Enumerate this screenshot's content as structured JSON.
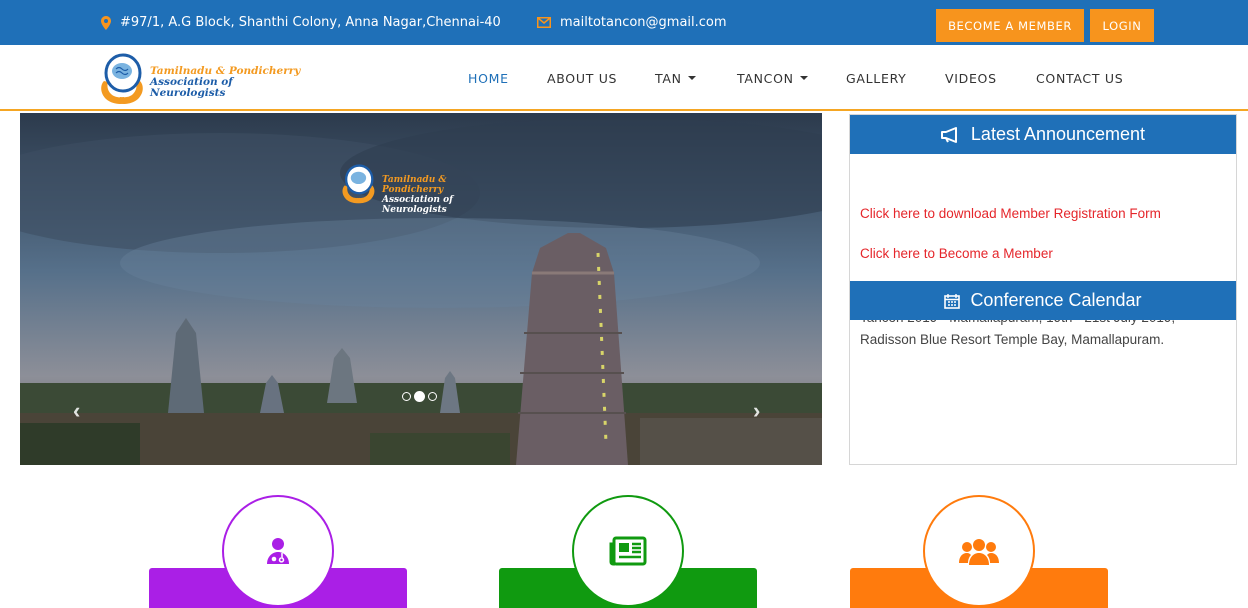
{
  "topbar": {
    "address": "#97/1, A.G Block, Shanthi Colony, Anna Nagar,Chennai-40",
    "email": "mailtotancon@gmail.com",
    "become_member": "BECOME A MEMBER",
    "login": "LOGIN",
    "icons": {
      "address": "map-marker-icon",
      "email": "envelope-icon"
    }
  },
  "logo": {
    "line1": "Tamilnadu & Pondicherry",
    "line2": "Association of Neurologists"
  },
  "nav": {
    "home": "HOME",
    "about": "ABOUT US",
    "tan": "TAN",
    "tancon": "TANCON",
    "gallery": "GALLERY",
    "videos": "VIDEOS",
    "contact": "CONTACT US"
  },
  "slider": {
    "active_slide": 2,
    "slide_count": 3
  },
  "announcement": {
    "title": "Latest Announcement",
    "links": [
      "Click here to download Member Registration Form",
      "Click here to Become a Member"
    ]
  },
  "calendar": {
    "title": "Conference Calendar",
    "entry": "Tancon 2019 - Mamallapuram, 19th - 21st July 2019, Radisson Blue Resort Temple Bay, Mamallapuram."
  },
  "features": [
    {
      "icon": "doctor-icon",
      "color": "#aa1fe6"
    },
    {
      "icon": "newspaper-icon",
      "color": "#109a10"
    },
    {
      "icon": "users-icon",
      "color": "#ff7b0d"
    }
  ],
  "colors": {
    "primary": "#1f70b8",
    "accent": "#f7941d",
    "link": "#e5262b"
  }
}
